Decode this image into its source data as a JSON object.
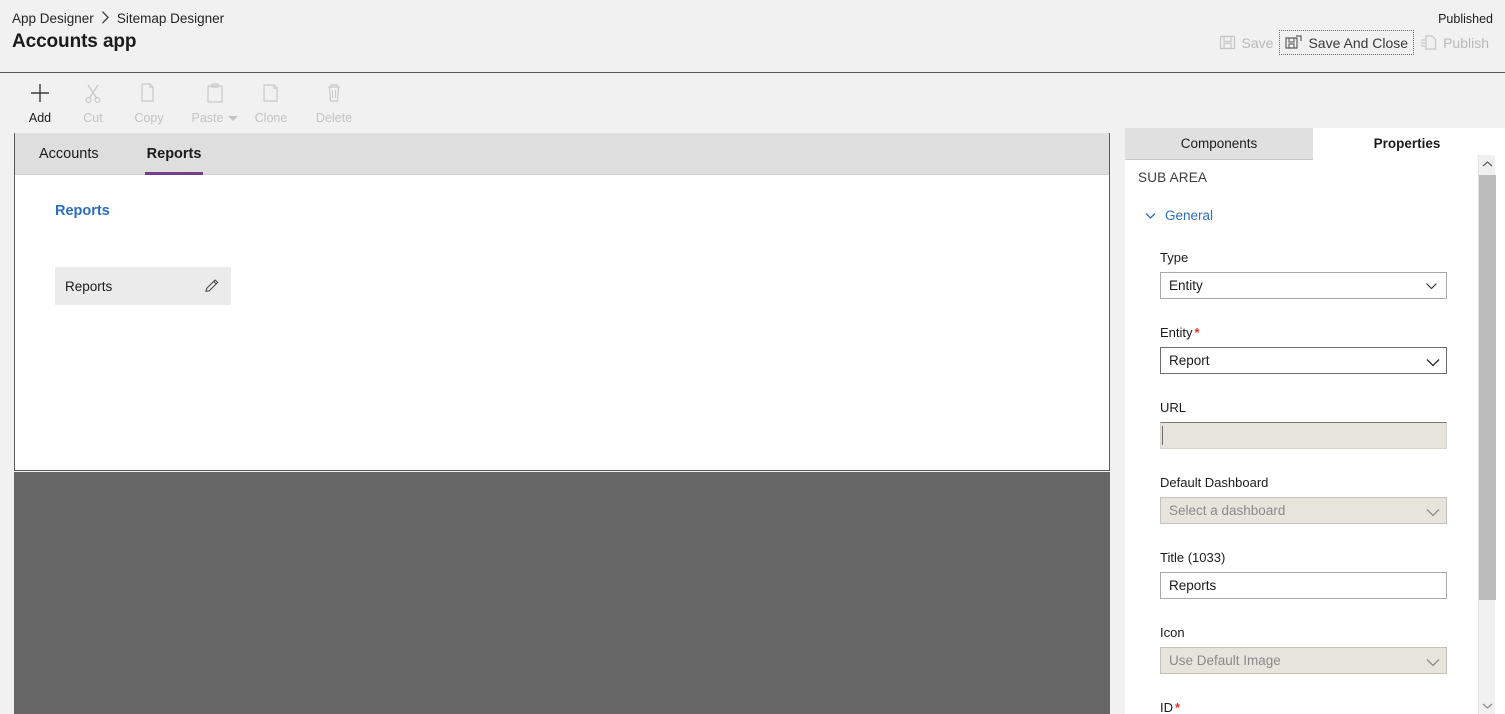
{
  "header": {
    "breadcrumb": [
      {
        "label": "App Designer",
        "icon": ""
      },
      {
        "label": "Sitemap Designer",
        "icon": ""
      }
    ],
    "breadcrumb_separator": "›",
    "app_title": "Accounts app",
    "status": "Published",
    "actions": [
      {
        "label": "Save",
        "icon": "save-icon",
        "disabled": true,
        "focused": false
      },
      {
        "label": "Save And Close",
        "icon": "save-and-close-icon",
        "disabled": false,
        "focused": true
      },
      {
        "label": "Publish",
        "icon": "publish-icon",
        "disabled": true,
        "focused": false
      }
    ]
  },
  "commandbar": {
    "items": [
      {
        "label": "Add",
        "icon": "plus-icon",
        "enabled": true,
        "has_caret": false
      },
      {
        "label": "Cut",
        "icon": "scissors-icon",
        "enabled": false,
        "has_caret": false
      },
      {
        "label": "Copy",
        "icon": "copy-icon",
        "enabled": false,
        "has_caret": false
      },
      {
        "label": "Paste",
        "icon": "paste-icon",
        "enabled": false,
        "has_caret": true
      },
      {
        "label": "Clone",
        "icon": "clone-icon",
        "enabled": false,
        "has_caret": false
      },
      {
        "label": "Delete",
        "icon": "trash-icon",
        "enabled": false,
        "has_caret": false
      }
    ]
  },
  "canvas": {
    "tabs": [
      {
        "label": "Accounts",
        "active": false
      },
      {
        "label": "Reports",
        "active": true
      }
    ],
    "active_tab_accent": "#773d8d",
    "group_title": "Reports",
    "group_title_color": "#2d6ebd",
    "subarea": {
      "title": "Reports",
      "edit_icon": "pencil-icon"
    }
  },
  "panel": {
    "tabs": [
      {
        "label": "Components",
        "active": false
      },
      {
        "label": "Properties",
        "active": true
      }
    ],
    "section_label": "SUB AREA",
    "group": {
      "label": "General",
      "expanded": true,
      "chevron_icon": "chevron-down-icon"
    },
    "fields": [
      {
        "label": "Type",
        "required": false,
        "control": "select",
        "value": "Entity",
        "placeholder": "",
        "disabled": false,
        "icon": "chevron-down-icon"
      },
      {
        "label": "Entity",
        "required": true,
        "control": "select",
        "value": "Report",
        "placeholder": "",
        "disabled": false,
        "icon": "chevron-down-icon"
      },
      {
        "label": "URL",
        "required": false,
        "control": "text",
        "value": "",
        "placeholder": "",
        "disabled": true,
        "icon": ""
      },
      {
        "label": "Default Dashboard",
        "required": false,
        "control": "select",
        "value": "",
        "placeholder": "Select a dashboard",
        "disabled": true,
        "icon": "chevron-down-icon"
      },
      {
        "label": "Title (1033)",
        "required": false,
        "control": "text",
        "value": "Reports",
        "placeholder": "",
        "disabled": false,
        "icon": ""
      },
      {
        "label": "Icon",
        "required": false,
        "control": "select",
        "value": "",
        "placeholder": "Use Default Image",
        "disabled": true,
        "icon": "chevron-down-icon"
      },
      {
        "label": "ID",
        "required": true,
        "control": "none",
        "value": "",
        "placeholder": "",
        "disabled": false,
        "icon": ""
      }
    ],
    "required_marker": "*",
    "required_color": "#d8372a",
    "scrollbar": {
      "up_icon": "chevron-up-icon",
      "down_icon": "chevron-down-icon"
    }
  }
}
